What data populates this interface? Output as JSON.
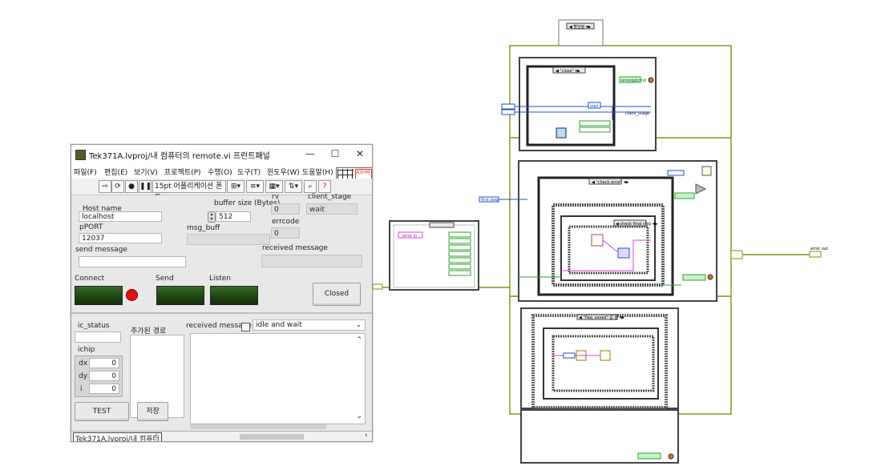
{
  "window": {
    "title": "Tek371A.lvproj/내 컴퓨터의 remote.vi 프런트패널",
    "min": "—",
    "max": "☐",
    "close": "✕"
  },
  "menu": [
    "파일(F)",
    "편집(E)",
    "보기(V)",
    "프로젝트(P)",
    "수행(O)",
    "도구(T)",
    "윈도우(W)",
    "도움말(H)"
  ],
  "toolbar": {
    "font": "15pt 어플리케이션 폰트",
    "font_arrow": "▾"
  },
  "vi_icon_text": "ASHM",
  "labels": {
    "host_name": "Host name",
    "buffer_size": "buffer size (Bytes)",
    "rv": "rv",
    "client_stage": "client_stage",
    "errcode": "errcode",
    "pport": "pPORT",
    "msg_buff": "msg_buff",
    "send_message": "send message",
    "received_message": "received message",
    "connect": "Connect",
    "send": "Send",
    "listen": "Listen",
    "ic_status": "ic_status",
    "added_path": "추가된 경로",
    "received_message2": "received message",
    "ichip": "ichip",
    "dx": "dx",
    "dy": "dy",
    "i": "i"
  },
  "values": {
    "host": "localhost",
    "buffer": "512",
    "rv": "0",
    "client_stage": "wait",
    "errcode": "0",
    "port": "12037",
    "dx": "0",
    "dy": "0",
    "i": "0",
    "dropdown": "idle and wait"
  },
  "buttons": {
    "closed": "Closed",
    "test": "TEST",
    "save": "저장"
  },
  "status": {
    "path": "Tek371A.lvproj/내 컴퓨터",
    "arrow_l": "‹",
    "arrow_r": "›"
  },
  "diagram": {
    "top_case": "◀ 할당됨 ▾▶",
    "close_case": "◀ \"close\" ▾▶",
    "wait": "wait",
    "client_stage": "client_stage",
    "flags": [
      "flag_closed",
      "flag_connected",
      "flag_listen",
      "flag_send",
      "flag_sent",
      "flag_received"
    ],
    "check_error": "◀ \"check error\" ▾▶",
    "check_final": "◀ check final chip ▾▶",
    "flag_saved": "◀ \"flag_saved\" 값 참 ▾▶",
    "first_step": "first step",
    "errorin": "error in",
    "errout": "error out",
    "errorgetcmd": "errorgetcmd",
    "check_button": "check"
  },
  "colors": {
    "led_green": "#1d4411",
    "wire_olive": "#8a8a1a",
    "wire_pink": "#e040e0",
    "wire_green": "#2fa02f",
    "wire_blue": "#2050d0"
  }
}
